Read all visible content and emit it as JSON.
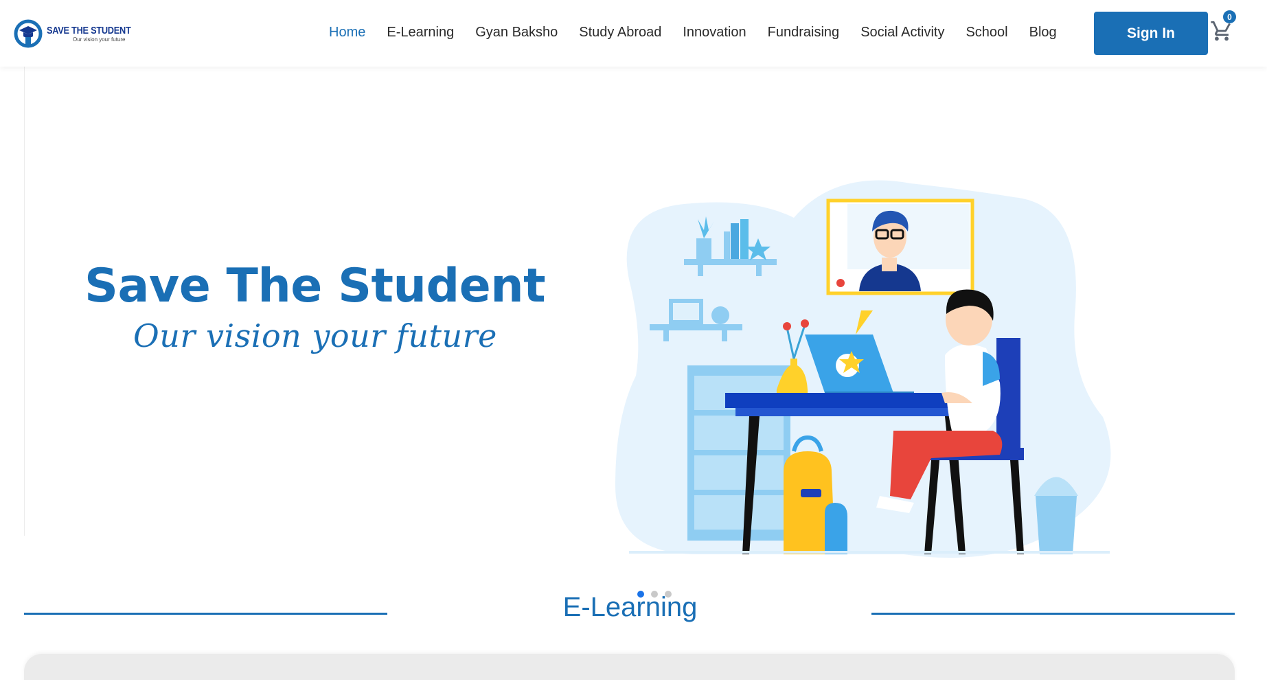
{
  "brand": {
    "name": "SAVE THE STUDENT",
    "tagline": "Our vision your future"
  },
  "nav": {
    "items": [
      {
        "label": "Home",
        "active": true
      },
      {
        "label": "E-Learning"
      },
      {
        "label": "Gyan Baksho"
      },
      {
        "label": "Study Abroad"
      },
      {
        "label": "Innovation"
      },
      {
        "label": "Fundraising"
      },
      {
        "label": "Social Activity"
      },
      {
        "label": "School"
      },
      {
        "label": "Blog"
      }
    ],
    "signin_label": "Sign In",
    "cart_count": "0"
  },
  "hero": {
    "title": "Save The Student",
    "subtitle": "Our vision your future",
    "slides": 3,
    "active_slide": 1
  },
  "section": {
    "title": "E-Learning"
  },
  "colors": {
    "primary": "#1a6fb5",
    "dot_active": "#1a73e8"
  }
}
